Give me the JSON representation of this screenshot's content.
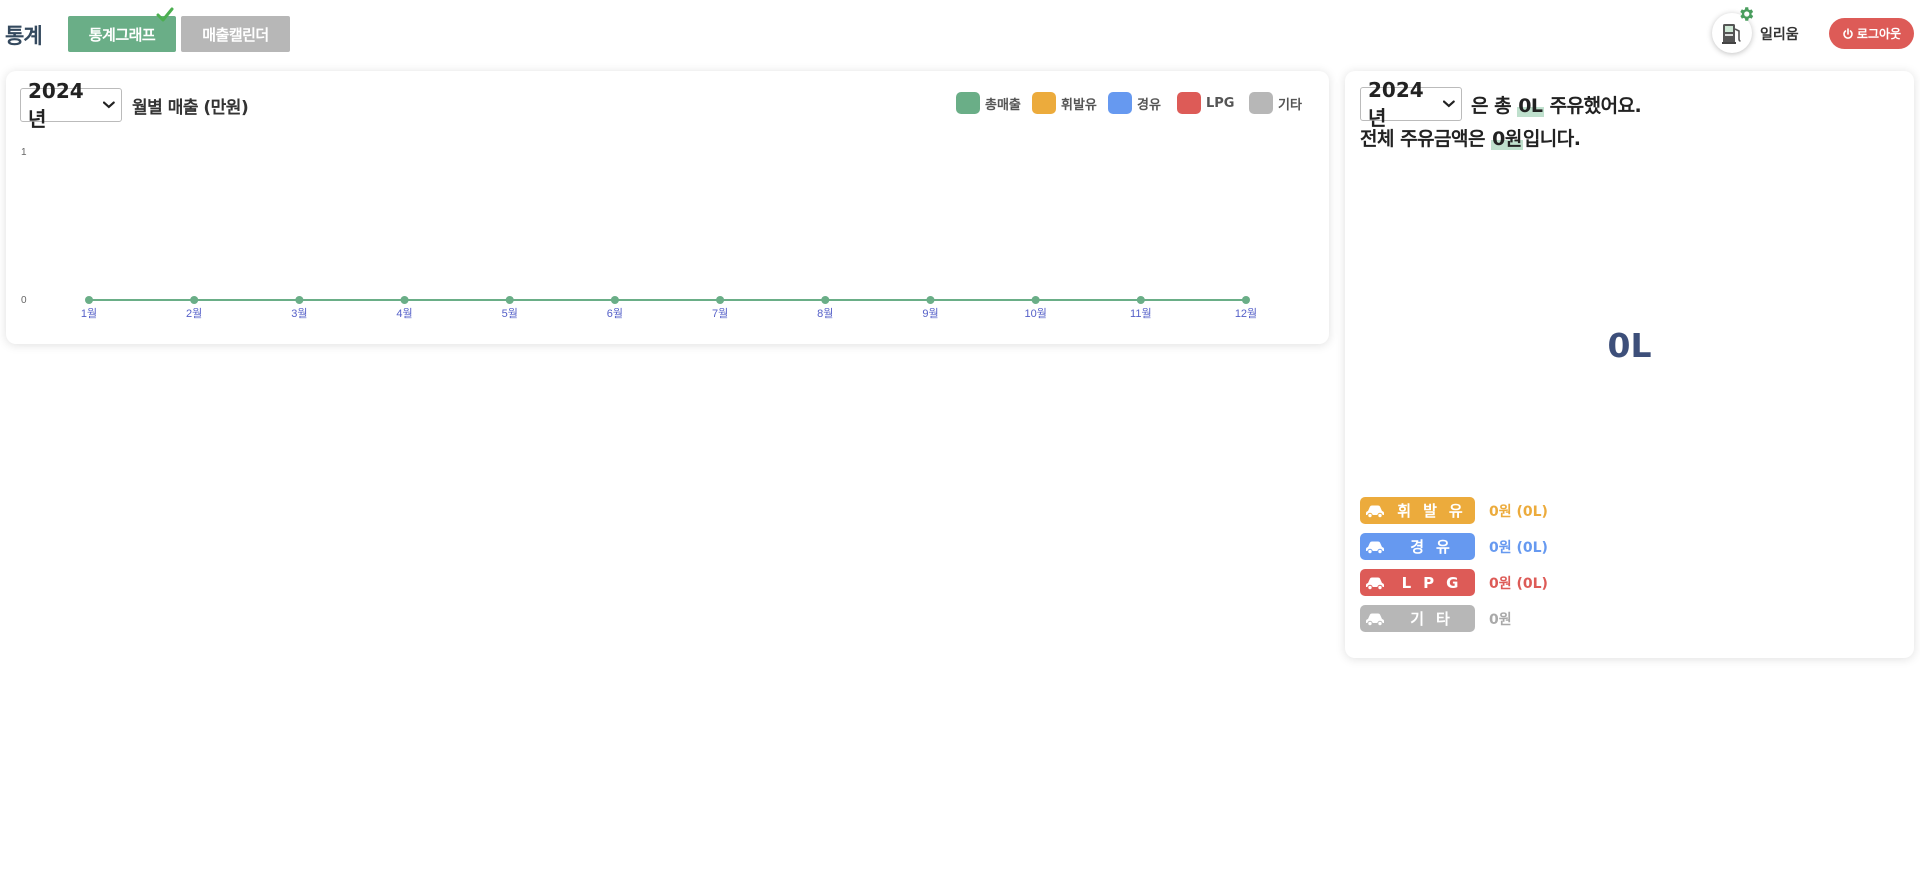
{
  "header": {
    "title": "통계",
    "tabs": [
      {
        "label": "통계그래프",
        "active": true
      },
      {
        "label": "매출캘린더",
        "active": false
      }
    ],
    "user_name": "일리움",
    "logout_label": "로그아웃"
  },
  "chart_card": {
    "year": "2024년",
    "title": "월별 매출 (만원)",
    "legend": [
      {
        "label": "총매출",
        "color": "#6aae87"
      },
      {
        "label": "휘발유",
        "color": "#ecab3c"
      },
      {
        "label": "경유",
        "color": "#6699f0"
      },
      {
        "label": "LPG",
        "color": "#dd5b57"
      },
      {
        "label": "기타",
        "color": "#b7b7b7"
      }
    ]
  },
  "chart_data": {
    "type": "line",
    "title": "월별 매출 (만원)",
    "xlabel": "",
    "ylabel": "",
    "categories": [
      "1월",
      "2월",
      "3월",
      "4월",
      "5월",
      "6월",
      "7월",
      "8월",
      "9월",
      "10월",
      "11월",
      "12월"
    ],
    "series": [
      {
        "name": "총매출",
        "color": "#6aae87",
        "values": [
          0,
          0,
          0,
          0,
          0,
          0,
          0,
          0,
          0,
          0,
          0,
          0
        ]
      }
    ],
    "yticks": [
      "0",
      "1"
    ],
    "ylim": [
      0,
      1
    ],
    "grid": false,
    "legend_position": "top-right"
  },
  "summary_card": {
    "year": "2024년",
    "line1_prefix": "은 총",
    "total_liters": "0L",
    "line1_suffix": "주유했어요.",
    "line2_prefix": "전체 주유금액은",
    "total_amount": "0원",
    "line2_suffix": "입니다.",
    "big_total": "0L",
    "fuels": [
      {
        "label": "휘발유",
        "value": "0원 (0L)",
        "color": "#ecab3c"
      },
      {
        "label": "경유",
        "value": "0원 (0L)",
        "color": "#6699f0"
      },
      {
        "label": "LPG",
        "value": "0원 (0L)",
        "color": "#dd5b57"
      },
      {
        "label": "기타",
        "value": "0원",
        "color": "#b7b7b7"
      }
    ]
  }
}
